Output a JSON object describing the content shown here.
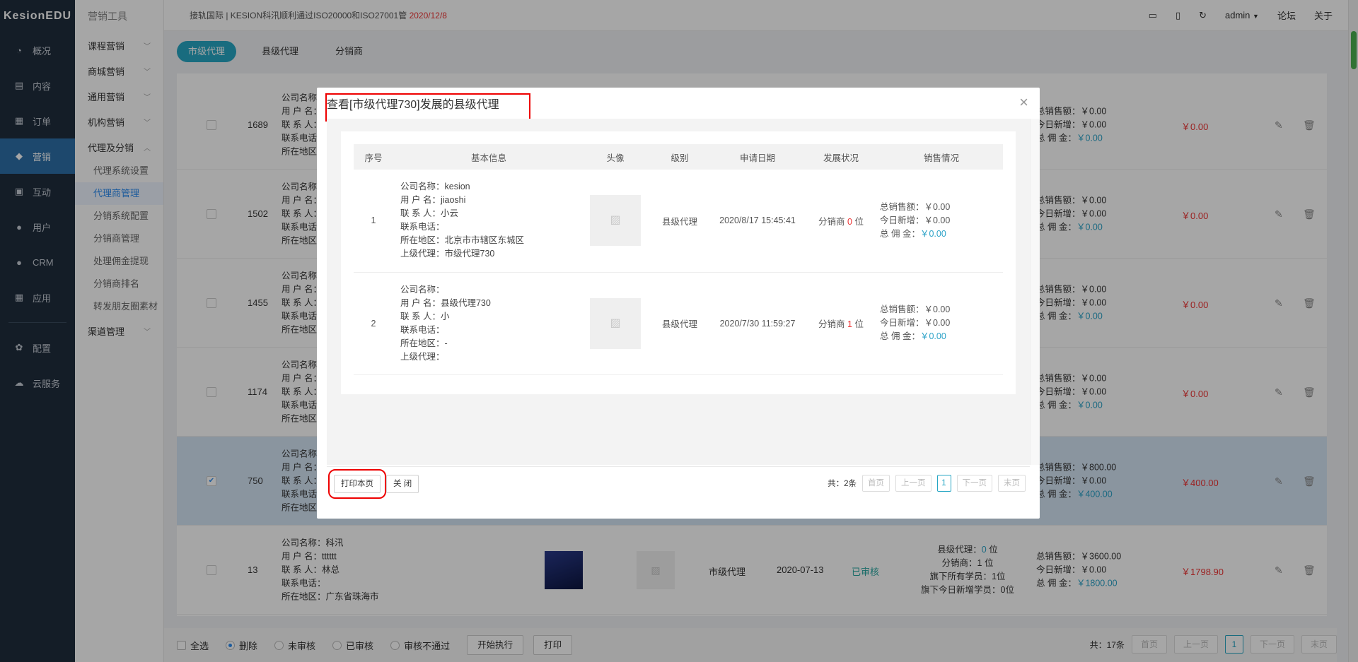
{
  "logo": "KesionEDU",
  "nav": [
    {
      "label": "概况",
      "icon": "dashboard-icon",
      "glyph": "◔"
    },
    {
      "label": "内容",
      "icon": "document-icon",
      "glyph": "▤"
    },
    {
      "label": "订单",
      "icon": "order-icon",
      "glyph": "▦"
    },
    {
      "label": "营销",
      "icon": "marketing-icon",
      "glyph": "◆"
    },
    {
      "label": "互动",
      "icon": "chat-icon",
      "glyph": "▣"
    },
    {
      "label": "用户",
      "icon": "user-icon",
      "glyph": "●"
    },
    {
      "label": "CRM",
      "icon": "crm-icon",
      "glyph": "●"
    },
    {
      "label": "应用",
      "icon": "apps-icon",
      "glyph": "▦"
    },
    {
      "label": "配置",
      "icon": "gear-icon",
      "glyph": "✿"
    },
    {
      "label": "云服务",
      "icon": "cloud-icon",
      "glyph": "☁"
    }
  ],
  "menu": {
    "title": "营销工具",
    "groups": [
      "课程营销",
      "商城营销",
      "通用营销",
      "机构营销",
      "代理及分销"
    ],
    "subs": [
      "代理系统设置",
      "代理商管理",
      "分销系统配置",
      "分销商管理",
      "处理佣金提现",
      "分销商排名",
      "转发朋友圈素材"
    ],
    "last_group": "渠道管理"
  },
  "topbar": {
    "notice": "接轨国际 | KESION科汛顺利通过ISO20000和ISO27001管",
    "notice_date": "2020/12/8",
    "user": "admin",
    "forum": "论坛",
    "about": "关于"
  },
  "tabs": [
    "市级代理",
    "县级代理",
    "分销商"
  ],
  "info_labels": {
    "company": "公司名称：",
    "user": "用 户 名：",
    "contact": "联 系 人：",
    "phone": "联系电话：",
    "region": "所在地区：",
    "parent": "上级代理："
  },
  "rows": [
    {
      "id": "1689",
      "total": "总销售额：￥0.00",
      "today": "今日新增：￥0.00",
      "comm_label": "总 佣 金：",
      "comm": "￥0.00",
      "price": "￥0.00"
    },
    {
      "id": "1502",
      "total": "总销售额：￥0.00",
      "today": "今日新增：￥0.00",
      "comm_label": "总 佣 金：",
      "comm": "￥0.00",
      "price": "￥0.00"
    },
    {
      "id": "1455",
      "total": "总销售额：￥0.00",
      "today": "今日新增：￥0.00",
      "comm_label": "总 佣 金：",
      "comm": "￥0.00",
      "price": "￥0.00"
    },
    {
      "id": "1174",
      "total": "总销售额：￥0.00",
      "today": "今日新增：￥0.00",
      "comm_label": "总 佣 金：",
      "comm": "￥0.00",
      "price": "￥0.00"
    },
    {
      "id": "750",
      "total": "总销售额：￥800.00",
      "today": "今日新增：￥0.00",
      "comm_label": "总 佣 金：",
      "comm": "￥400.00",
      "price": "￥400.00"
    }
  ],
  "last_row": {
    "id": "13",
    "company": "公司名称：科汛",
    "user": "用 户 名：tttttt",
    "contact": "联 系 人：林总",
    "phone": "联系电话：",
    "region": "所在地区：广东省珠海市",
    "level": "市级代理",
    "date": "2020-07-13",
    "status": "已审核",
    "dev_county_label": "县级代理：",
    "dev_county": "0",
    "dev_unit": " 位",
    "dev_dist_label": "分销商：",
    "dev_dist": "1",
    "dev_students": "旗下所有学员：1位",
    "dev_today": "旗下今日新增学员：0位",
    "total": "总销售额：￥3600.00",
    "today": "今日新增：￥0.00",
    "comm_label": "总 佣 金：",
    "comm": "￥1800.00",
    "price": "￥1798.90"
  },
  "bottom": {
    "select_all": "全选",
    "delete": "删除",
    "unreviewed": "未审核",
    "reviewed": "已审核",
    "rejected": "审核不通过",
    "execute": "开始执行",
    "print": "打印",
    "total": "共：17条",
    "first": "首页",
    "prev": "上一页",
    "page": "1",
    "next": "下一页",
    "last": "末页"
  },
  "modal": {
    "title": "查看[市级代理730]发展的县级代理",
    "headers": [
      "序号",
      "基本信息",
      "头像",
      "级别",
      "申请日期",
      "发展状况",
      "销售情况"
    ],
    "rows": [
      {
        "no": "1",
        "company": "公司名称：kesion",
        "user": "用 户 名：jiaoshi",
        "contact": "联 系 人：小云",
        "phone": "联系电话：",
        "region": "所在地区：北京市市辖区东城区",
        "parent": "上级代理：市级代理730",
        "level": "县级代理",
        "date": "2020/8/17 15:45:41",
        "dev_pre": "分销商 ",
        "dev_num": "0",
        "dev_post": " 位",
        "total": "总销售额：￥0.00",
        "today": "今日新增：￥0.00",
        "comm_label": "总 佣 金：",
        "comm": "￥0.00"
      },
      {
        "no": "2",
        "company": "公司名称：",
        "user": "用 户 名：县级代理730",
        "contact": "联 系 人：小",
        "phone": "联系电话：",
        "region": "所在地区：-",
        "parent": "上级代理：",
        "level": "县级代理",
        "date": "2020/7/30 11:59:27",
        "dev_pre": "分销商 ",
        "dev_num": "1",
        "dev_post": " 位",
        "total": "总销售额：￥0.00",
        "today": "今日新增：￥0.00",
        "comm_label": "总 佣 金：",
        "comm": "￥0.00"
      }
    ],
    "print_page": "打印本页",
    "close": "关 闭",
    "total": "共：2条",
    "first": "首页",
    "prev": "上一页",
    "page": "1",
    "next": "下一页",
    "last": "末页"
  },
  "colors": {
    "accent": "#27a6c4",
    "price_red": "#e33333",
    "nav_bg": "#1f2d3d",
    "highlight_box": "#ee0000"
  }
}
